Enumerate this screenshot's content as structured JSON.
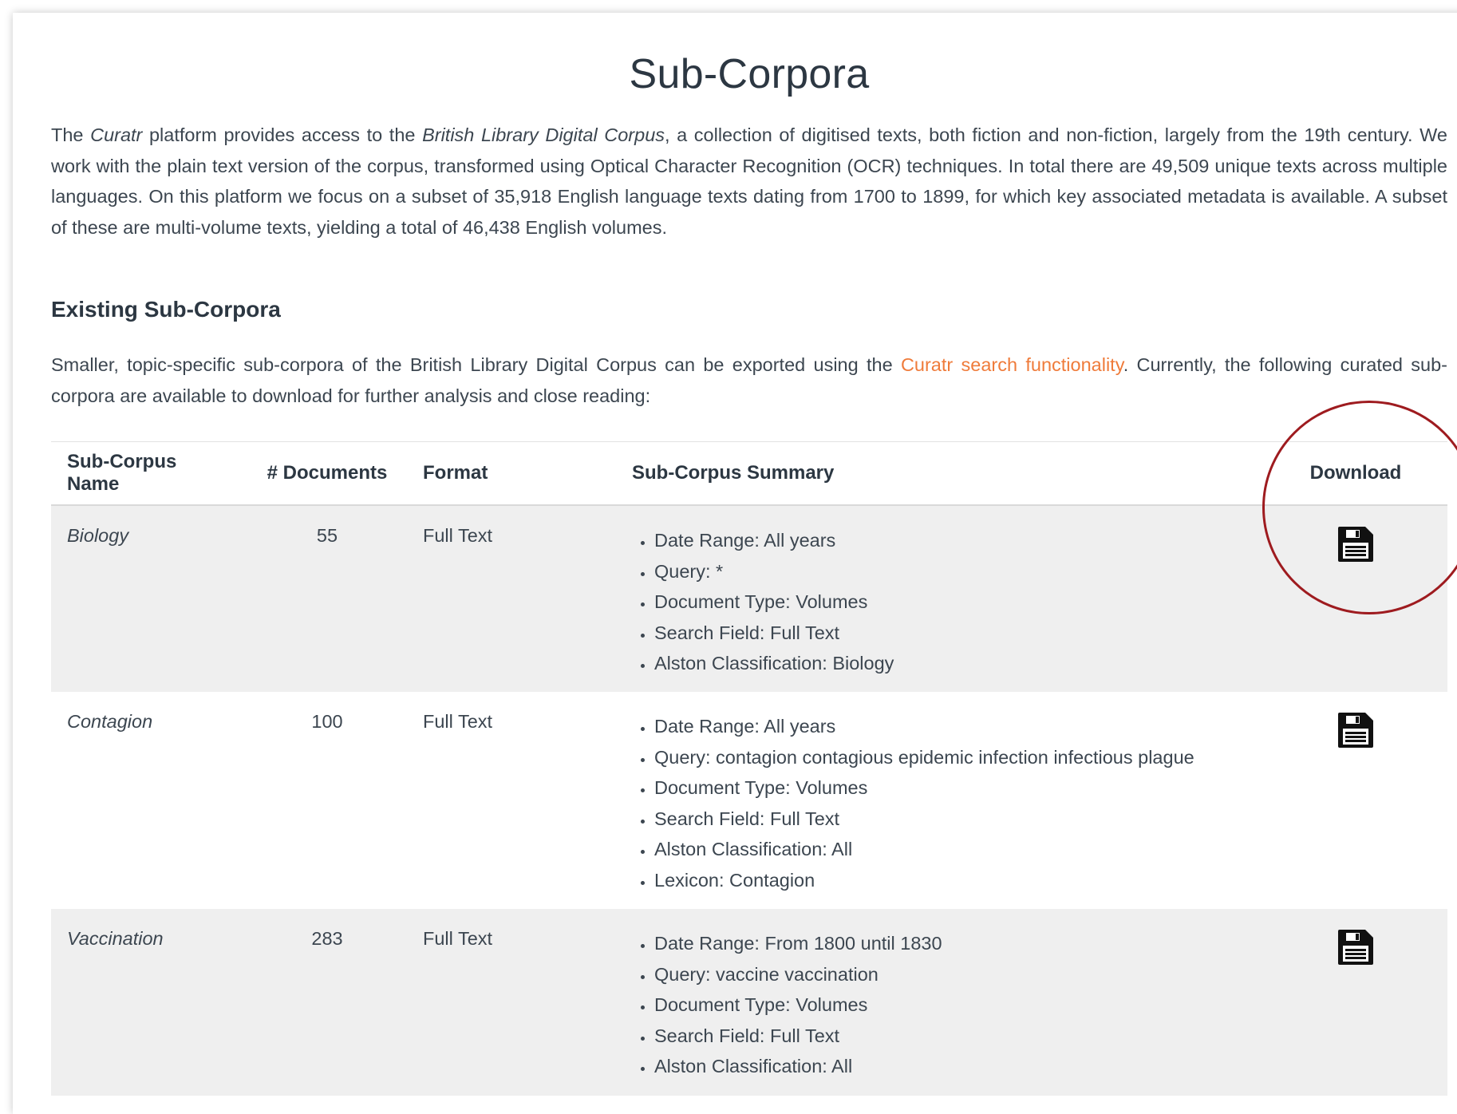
{
  "page": {
    "title": "Sub-Corpora",
    "intro": {
      "p1": "The ",
      "curatr": "Curatr",
      "p2": " platform provides access to the ",
      "bldc": "British Library Digital Corpus",
      "p3": ", a collection of digitised texts, both fiction and non-fiction, largely from the 19th century. We work with the plain text version of the corpus, transformed using Optical Character Recognition (OCR) techniques. In total there are 49,509 unique texts across multiple languages. On this platform we focus on a subset of 35,918 English language texts dating from 1700 to 1899, for which key associated metadata is available. A subset of these are multi-volume texts, yielding a total of 46,438 English volumes."
    },
    "section_heading": "Existing Sub-Corpora",
    "section_text": {
      "before_link": "Smaller, topic-specific sub-corpora of the British Library Digital Corpus can be exported using the ",
      "link": "Curatr search functionality",
      "after_link": ". Currently, the following curated sub-corpora are available to download for further analysis and close reading:"
    }
  },
  "table": {
    "headers": {
      "name": "Sub-Corpus Name",
      "docs": "# Documents",
      "format": "Format",
      "summary": "Sub-Corpus Summary",
      "download": "Download"
    },
    "rows": [
      {
        "name": "Biology",
        "docs": "55",
        "format": "Full Text",
        "summary": [
          "Date Range: All years",
          "Query: *",
          "Document Type: Volumes",
          "Search Field: Full Text",
          "Alston Classification: Biology"
        ],
        "download_icon": "floppy-disk-icon"
      },
      {
        "name": "Contagion",
        "docs": "100",
        "format": "Full Text",
        "summary": [
          "Date Range: All years",
          "Query: contagion contagious epidemic infection infectious plague",
          "Document Type: Volumes",
          "Search Field: Full Text",
          "Alston Classification: All",
          "Lexicon: Contagion"
        ],
        "download_icon": "floppy-disk-icon"
      },
      {
        "name": "Vaccination",
        "docs": "283",
        "format": "Full Text",
        "summary": [
          "Date Range: From 1800 until 1830",
          "Query: vaccine vaccination",
          "Document Type: Volumes",
          "Search Field: Full Text",
          "Alston Classification: All"
        ],
        "download_icon": "floppy-disk-icon"
      }
    ]
  },
  "colors": {
    "link": "#ef7b3a",
    "row_shade": "#efefef",
    "highlight_circle": "#9e1b1f",
    "heading": "#2c3742"
  }
}
